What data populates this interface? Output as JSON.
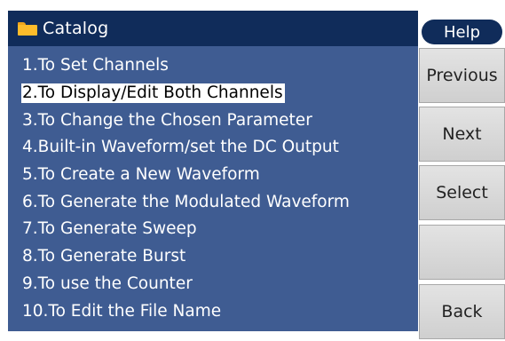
{
  "window": {
    "title": "Catalog",
    "icon": "folder-icon"
  },
  "menu": {
    "items": [
      {
        "label": "1.To Set Channels"
      },
      {
        "label": "2.To Display/Edit Both Channels",
        "selected": true
      },
      {
        "label": "3.To Change the Chosen Parameter"
      },
      {
        "label": "4.Built-in Waveform/set the DC Output"
      },
      {
        "label": "5.To Create a New Waveform"
      },
      {
        "label": "6.To Generate the Modulated Waveform"
      },
      {
        "label": "7.To Generate Sweep"
      },
      {
        "label": "8.To Generate Burst"
      },
      {
        "label": "9.To use the Counter"
      },
      {
        "label": "10.To Edit the File Name"
      }
    ]
  },
  "softkeys": {
    "help": "Help",
    "previous": "Previous",
    "next": "Next",
    "select": "Select",
    "blank": "",
    "back": "Back"
  },
  "colors": {
    "panel_bg": "#3f5c92",
    "title_bg": "#102c5a",
    "selected_bg": "#ffffff",
    "button_bg": "#d9d9d9",
    "folder": "#fdbc2b"
  }
}
